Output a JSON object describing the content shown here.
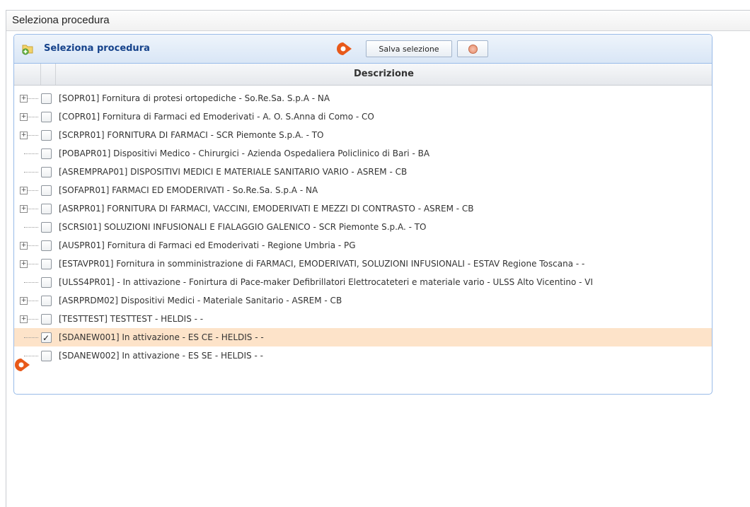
{
  "window": {
    "title": "Seleziona procedura"
  },
  "panel": {
    "title": "Seleziona procedura",
    "save_label": "Salva selezione",
    "column_header": "Descrizione"
  },
  "rows": [
    {
      "label": "[SOPR01] Fornitura di protesi ortopediche - So.Re.Sa. S.p.A - NA",
      "expandable": true,
      "checked": false
    },
    {
      "label": "[COPR01] Fornitura di Farmaci ed Emoderivati - A. O. S.Anna di Como - CO",
      "expandable": true,
      "checked": false
    },
    {
      "label": "[SCRPR01] FORNITURA DI FARMACI - SCR Piemonte S.p.A. - TO",
      "expandable": true,
      "checked": false
    },
    {
      "label": "[POBAPR01] Dispositivi Medico - Chirurgici - Azienda Ospedaliera Policlinico di Bari - BA",
      "expandable": false,
      "checked": false
    },
    {
      "label": "[ASREMPRAP01] DISPOSITIVI MEDICI E MATERIALE SANITARIO VARIO - ASREM - CB",
      "expandable": false,
      "checked": false
    },
    {
      "label": "[SOFAPR01] FARMACI ED EMODERIVATI - So.Re.Sa. S.p.A - NA",
      "expandable": true,
      "checked": false
    },
    {
      "label": "[ASRPR01] FORNITURA DI FARMACI, VACCINI, EMODERIVATI E MEZZI DI CONTRASTO - ASREM - CB",
      "expandable": true,
      "checked": false
    },
    {
      "label": "[SCRSI01] SOLUZIONI INFUSIONALI E FIALAGGIO GALENICO - SCR Piemonte S.p.A. - TO",
      "expandable": false,
      "checked": false
    },
    {
      "label": "[AUSPR01] Fornitura di Farmaci ed Emoderivati - Regione Umbria - PG",
      "expandable": true,
      "checked": false
    },
    {
      "label": "[ESTAVPR01] Fornitura in somministrazione di FARMACI, EMODERIVATI, SOLUZIONI INFUSIONALI - ESTAV Regione Toscana - -",
      "expandable": true,
      "checked": false
    },
    {
      "label": "[ULSS4PR01] - In attivazione - Fonirtura di Pace-maker Defibrillatori Elettrocateteri e materiale vario - ULSS Alto Vicentino - VI",
      "expandable": false,
      "checked": false
    },
    {
      "label": "[ASRPRDM02] Dispositivi Medici - Materiale Sanitario - ASREM - CB",
      "expandable": true,
      "checked": false
    },
    {
      "label": "[TESTTEST] TESTTEST - HELDIS - -",
      "expandable": true,
      "checked": false
    },
    {
      "label": "[SDANEW001] In attivazione - ES CE - HELDIS - -",
      "expandable": false,
      "checked": true,
      "selected": true
    },
    {
      "label": "[SDANEW002] In attivazione - ES SE - HELDIS - -",
      "expandable": false,
      "checked": false
    }
  ],
  "colors": {
    "marker": "#e8591a",
    "selected_row": "#fde3c9",
    "panel_title": "#15428b"
  },
  "icons": {
    "panel": "add-folder-icon",
    "cancel": "cancel-icon",
    "marker": "pin-marker-icon"
  }
}
